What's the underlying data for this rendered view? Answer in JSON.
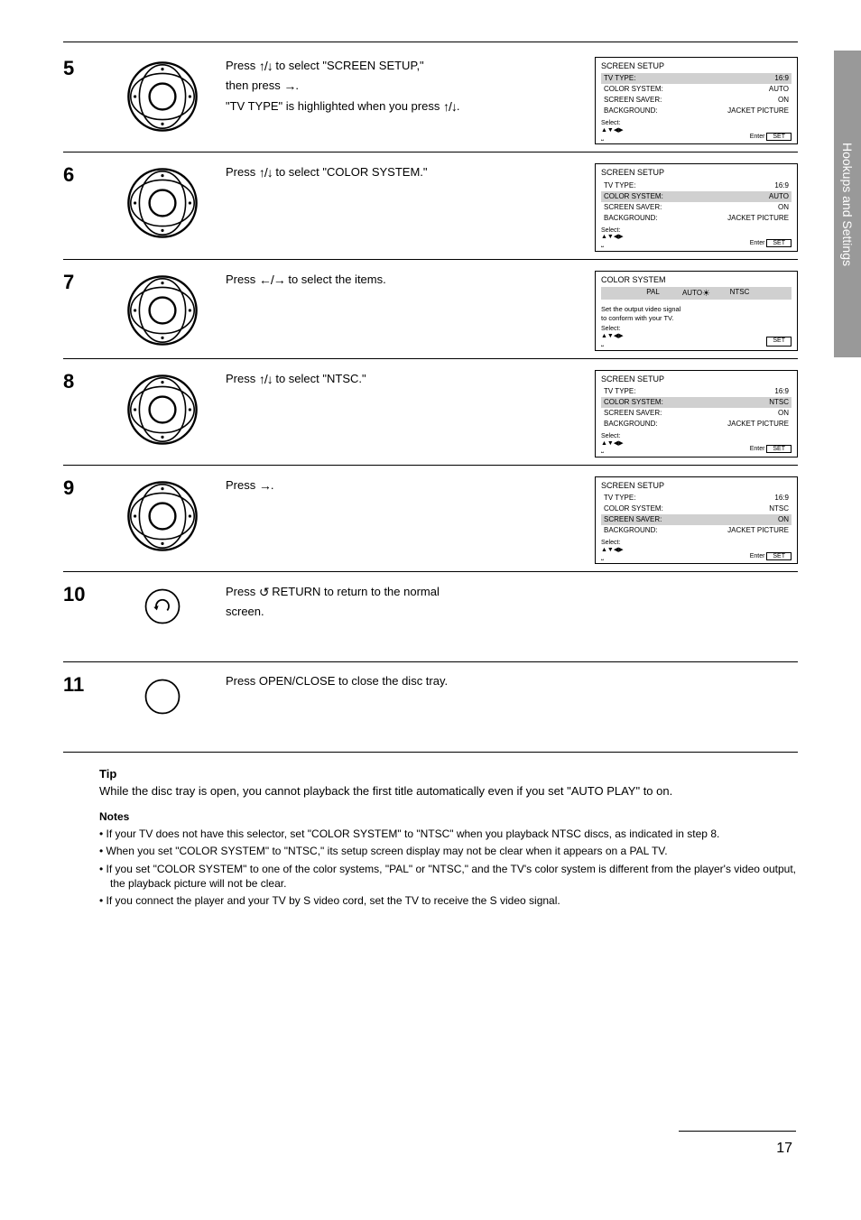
{
  "side_tab": "Hookups and Settings",
  "steps": [
    {
      "num": "5",
      "instruction_lines": [
        {
          "prefix": "Press ",
          "arrow": "↑/↓",
          "suffix": " to select \"SCREEN SETUP,\""
        },
        {
          "prefix": "then press ",
          "arrow": "→",
          "suffix": "."
        },
        {
          "prefix": "\"TV TYPE\" is highlighted when you press ",
          "arrow": "↑/↓",
          "suffix": "."
        }
      ],
      "screen": {
        "title": "SCREEN SETUP",
        "items": [
          {
            "k": "TV TYPE:",
            "v": "16:9",
            "hl": true
          },
          {
            "k": "COLOR SYSTEM:",
            "v": "AUTO"
          },
          {
            "k": "SCREEN SAVER:",
            "v": "ON"
          },
          {
            "k": "BACKGROUND:",
            "v": "JACKET PICTURE"
          }
        ],
        "footer": {
          "select": "Select:",
          "enter": "Enter",
          "set": "SET"
        }
      }
    },
    {
      "num": "6",
      "instruction_lines": [
        {
          "prefix": "Press ",
          "arrow": "↑/↓",
          "suffix": " to select \"COLOR SYSTEM.\""
        }
      ],
      "screen": {
        "title": "SCREEN SETUP",
        "items": [
          {
            "k": "TV TYPE:",
            "v": "16:9"
          },
          {
            "k": "COLOR SYSTEM:",
            "v": "AUTO",
            "hl": true
          },
          {
            "k": "SCREEN SAVER:",
            "v": "ON"
          },
          {
            "k": "BACKGROUND:",
            "v": "JACKET PICTURE"
          }
        ],
        "footer": {
          "select": "Select:",
          "enter": "Enter",
          "set": "SET"
        }
      }
    },
    {
      "num": "7",
      "instruction_lines": [
        {
          "prefix": "Press ",
          "arrow": "←/→",
          "suffix": " to select the items."
        }
      ],
      "screen": {
        "type": "color-system",
        "title": "COLOR SYSTEM",
        "options": [
          "PAL",
          "AUTO",
          "NTSC"
        ],
        "selected": "AUTO",
        "info_lines": [
          "Set the output video signal",
          "to conform with your TV."
        ],
        "footer": {
          "select": "Select:",
          "set": "SET"
        }
      }
    },
    {
      "num": "8",
      "instruction_lines": [
        {
          "prefix": "Press ",
          "arrow": "↑/↓",
          "suffix": " to select \"NTSC.\""
        }
      ],
      "screen": {
        "title": "SCREEN SETUP",
        "items": [
          {
            "k": "TV TYPE:",
            "v": "16:9"
          },
          {
            "k": "COLOR SYSTEM:",
            "v": "NTSC",
            "hl": true
          },
          {
            "k": "SCREEN SAVER:",
            "v": "ON"
          },
          {
            "k": "BACKGROUND:",
            "v": "JACKET PICTURE"
          }
        ],
        "footer": {
          "select": "Select:",
          "enter": "Enter",
          "set": "SET"
        }
      }
    },
    {
      "num": "9",
      "instruction_lines": [
        {
          "prefix": "Press ",
          "arrow": "→",
          "suffix": "."
        }
      ],
      "screen": {
        "title": "SCREEN SETUP",
        "items": [
          {
            "k": "TV TYPE:",
            "v": "16:9"
          },
          {
            "k": "COLOR SYSTEM:",
            "v": "NTSC"
          },
          {
            "k": "SCREEN SAVER:",
            "v": "ON",
            "hl": true
          },
          {
            "k": "BACKGROUND:",
            "v": "JACKET PICTURE"
          }
        ],
        "footer": {
          "select": "Select:",
          "enter": "Enter",
          "set": "SET"
        }
      }
    },
    {
      "num": "10",
      "button": "return",
      "instruction_lines": [
        {
          "prefix": "Press ",
          "arrow": "↺",
          "suffix": " RETURN to return to the normal"
        },
        {
          "prefix": "screen.",
          "arrow": "",
          "suffix": ""
        }
      ]
    },
    {
      "num": "11",
      "button": "open",
      "instruction_lines": [
        {
          "prefix": "Press OPEN/CLOSE to close the disc tray.",
          "arrow": "",
          "suffix": ""
        }
      ]
    }
  ],
  "tip": {
    "heading": "Tip",
    "text": "While the disc tray is open, you cannot playback the first title automatically even if you set \"AUTO PLAY\" to on."
  },
  "notes": {
    "heading": "Notes",
    "items": [
      "If your TV does not have this selector, set \"COLOR SYSTEM\" to \"NTSC\" when you playback NTSC discs, as indicated in step 8.",
      "When you set \"COLOR SYSTEM\" to \"NTSC,\" its setup screen display may not be clear when it appears on a PAL TV.",
      "If you set \"COLOR SYSTEM\" to one of the color systems, \"PAL\" or \"NTSC,\" and the TV's color system is different from the player's video output, the playback picture will not be clear.",
      "If you connect the player and your TV by S video cord, set the TV to receive the S video signal."
    ]
  },
  "page_number": "17"
}
